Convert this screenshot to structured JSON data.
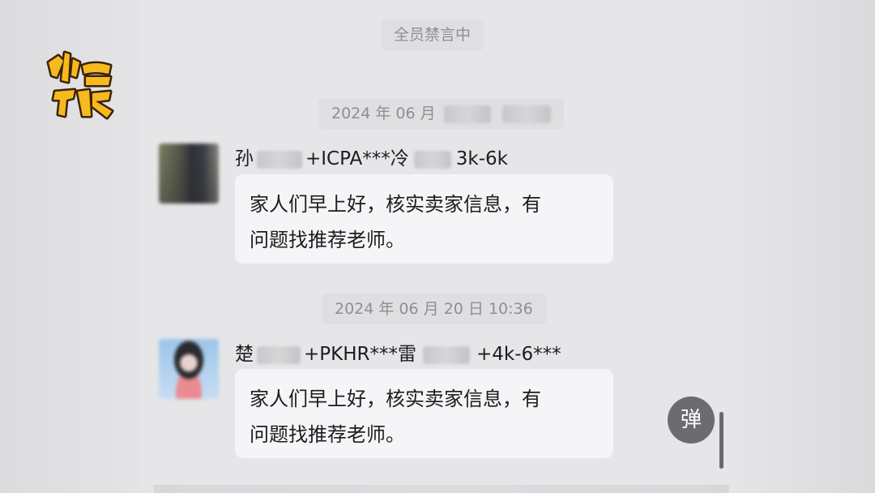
{
  "watermark": {
    "text": "小强热线",
    "colors": {
      "fill": "#f6b91f",
      "outline": "#3a2308"
    }
  },
  "system": {
    "muted_notice": "全员禁言中"
  },
  "messages": [
    {
      "timestamp_visible": "2024 年 06 月",
      "sender_prefix": "孙",
      "sender_middle": "+ICPA***冷",
      "sender_suffix": "3k-6k",
      "text_line1": "家人们早上好，核实卖家信息，有",
      "text_line2": "问题找推荐老师。"
    },
    {
      "timestamp": "2024 年 06 月 20 日 10:36",
      "sender_prefix": "楚",
      "sender_middle": "+PKHR***雷",
      "sender_suffix": "+4k-6***",
      "text_line1": "家人们早上好，核实卖家信息，有",
      "text_line2": "问题找推荐老师。"
    }
  ],
  "controls": {
    "danmu_button": "弹"
  },
  "colors": {
    "background": "#e6e6e8",
    "bubble": "#f5f5f7",
    "chip_text": "#8f8f92",
    "danmu_button_bg": "#6b6b70"
  }
}
